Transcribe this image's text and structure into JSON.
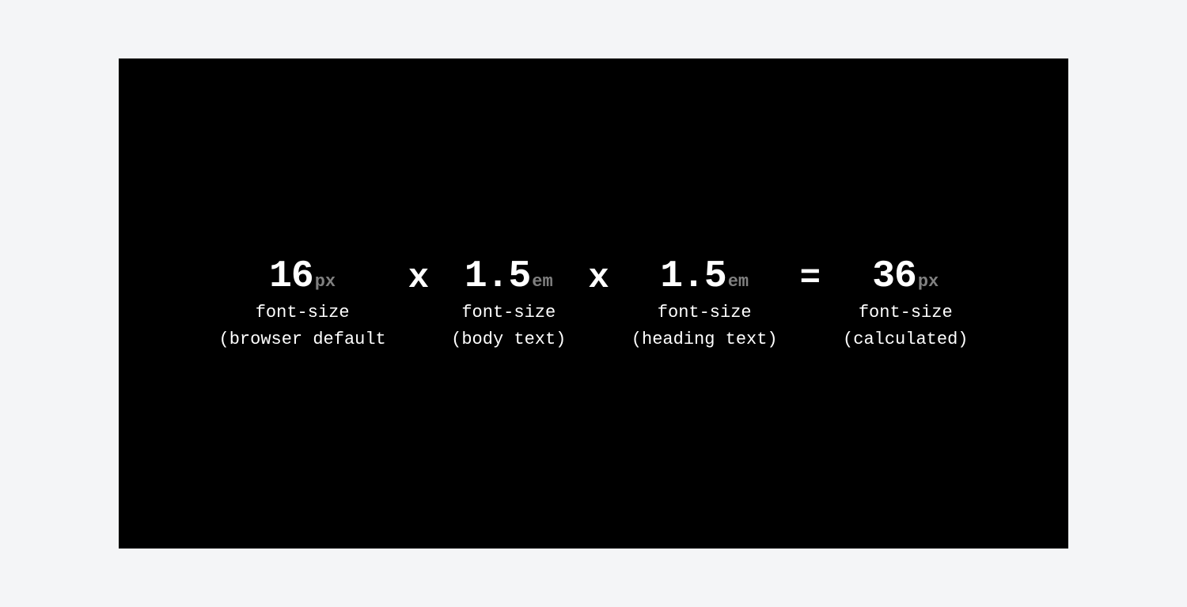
{
  "terms": [
    {
      "value": "16",
      "unit": "px",
      "label1": "font-size",
      "label2": "(browser default"
    },
    {
      "value": "1.5",
      "unit": "em",
      "label1": "font-size",
      "label2": "(body text)"
    },
    {
      "value": "1.5",
      "unit": "em",
      "label1": "font-size",
      "label2": "(heading text)"
    },
    {
      "value": "36",
      "unit": "px",
      "label1": "font-size",
      "label2": "(calculated)"
    }
  ],
  "operators": {
    "multiply": "x",
    "equals": "="
  }
}
